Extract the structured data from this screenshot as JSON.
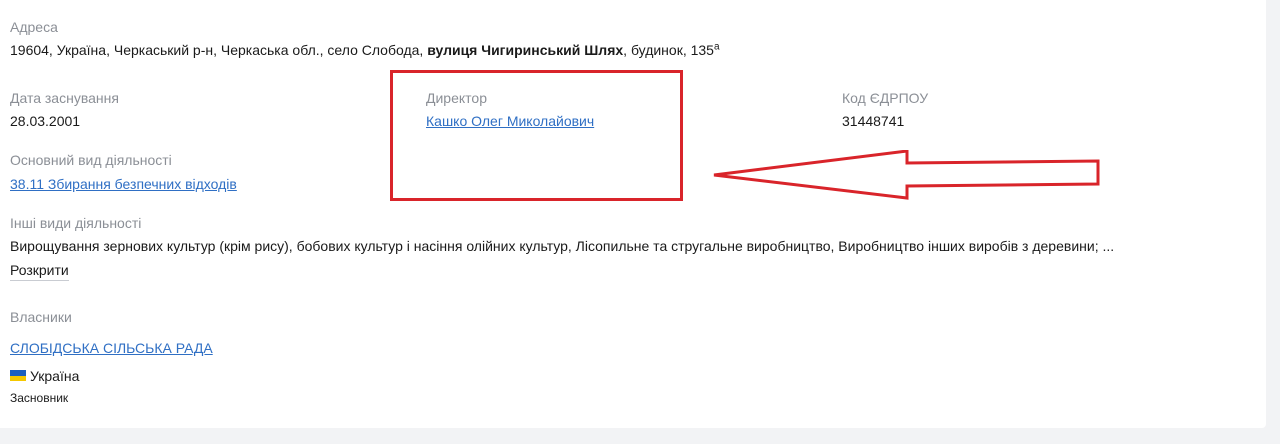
{
  "address": {
    "label": "Адреса",
    "prefix": "19604, Україна, Черкаський р-н, Черкаська обл., село Слобода, ",
    "street": "вулиця Чигиринський Шлях",
    "suffix": ", будинок, 135",
    "suffix_sup": "а"
  },
  "founded": {
    "label": "Дата заснування",
    "value": "28.03.2001"
  },
  "director": {
    "label": "Директор",
    "name": "Кашко Олег Миколайович"
  },
  "edrpou": {
    "label": "Код ЄДРПОУ",
    "value": "31448741"
  },
  "main_activity": {
    "label": "Основний вид діяльності",
    "value": "38.11 Збирання безпечних відходів"
  },
  "other_activities": {
    "label": "Інші види діяльності",
    "value": "Вирощування зернових культур (крім рису), бобових культур і насіння олійних культур, Лісопильне та стругальне виробництво, Виробництво інших виробів з деревини; ...",
    "expand_label": "Розкрити"
  },
  "owners": {
    "label": "Власники",
    "items": [
      {
        "name": "СЛОБІДСЬКА СІЛЬСЬКА РАДА",
        "country": "Україна",
        "role": "Засновник"
      }
    ]
  },
  "colors": {
    "annotation": "#d9242a",
    "link": "#2f6fc4",
    "label": "#8b8f96"
  }
}
